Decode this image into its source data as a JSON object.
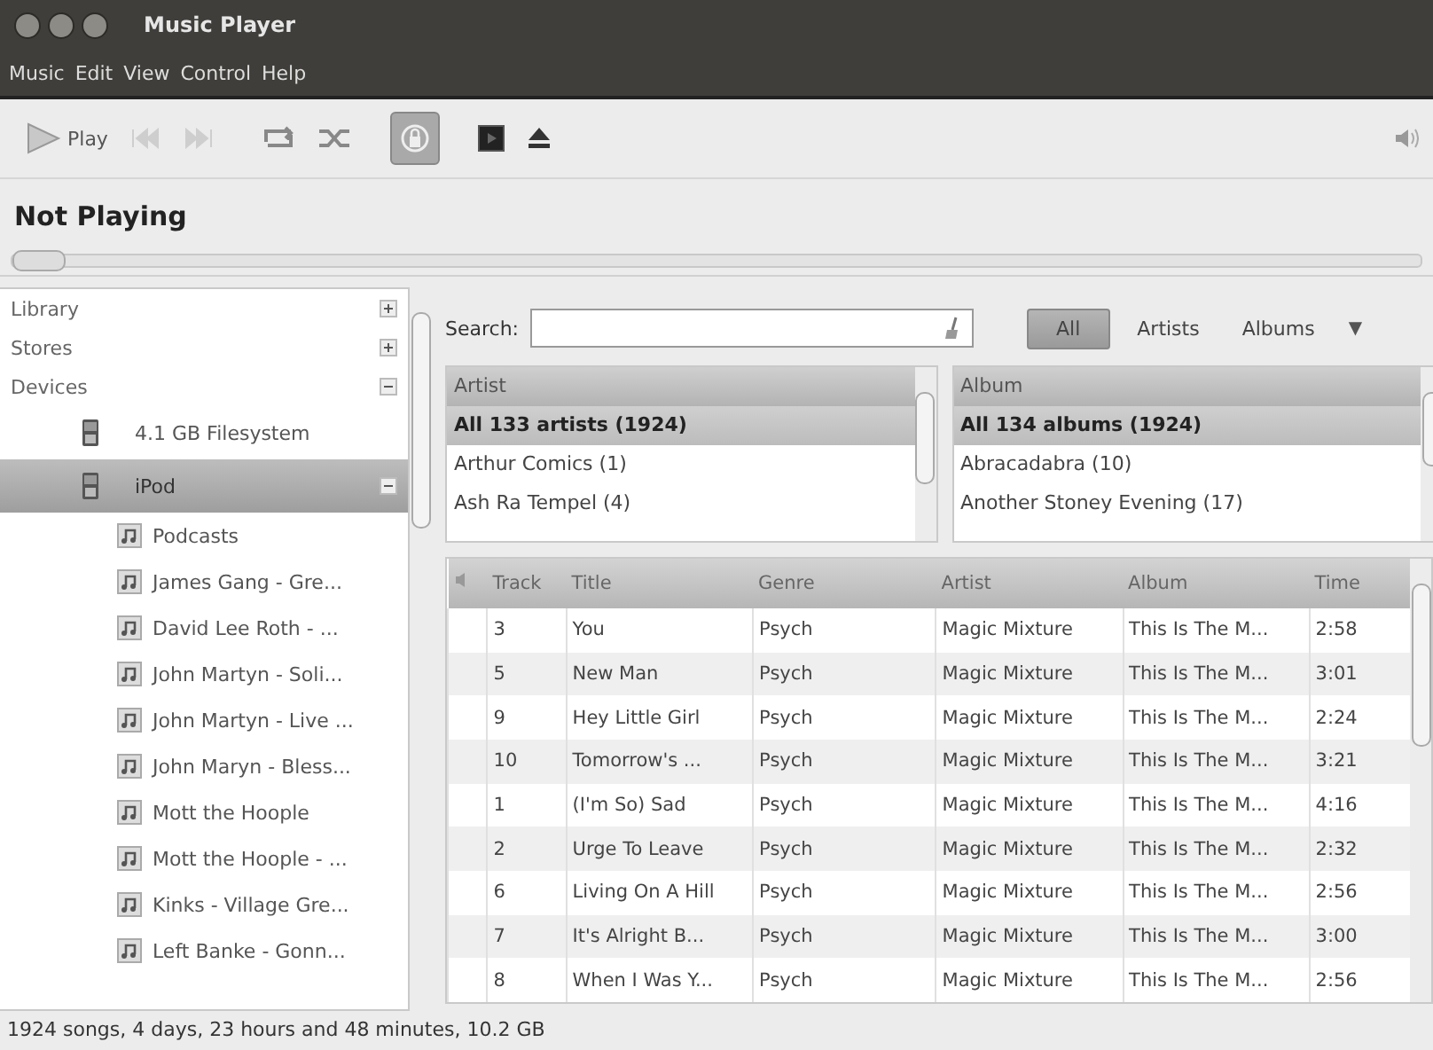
{
  "window": {
    "title": "Music Player"
  },
  "menu": [
    "Music",
    "Edit",
    "View",
    "Control",
    "Help"
  ],
  "toolbar": {
    "buttons": [
      {
        "kind": "play",
        "label": "Play",
        "disabled": false,
        "on": false
      },
      {
        "kind": "previous",
        "disabled": true,
        "on": false
      },
      {
        "kind": "next",
        "disabled": true,
        "on": false
      },
      {
        "kind": "repeat",
        "disabled": false,
        "on": false
      },
      {
        "kind": "shuffle",
        "disabled": false,
        "on": false
      },
      {
        "kind": "sync",
        "disabled": false,
        "on": true
      },
      {
        "kind": "visualizer",
        "disabled": false,
        "on": false
      },
      {
        "kind": "eject",
        "disabled": false,
        "on": false
      }
    ]
  },
  "now_playing": "Not Playing",
  "seek": {
    "level": 0
  },
  "sidebar": {
    "items": [
      {
        "label": "Library",
        "kind": "category",
        "expanded": false,
        "selected": false
      },
      {
        "label": "Stores",
        "kind": "category",
        "expanded": false,
        "selected": false
      },
      {
        "label": "Devices",
        "kind": "category",
        "expanded": true,
        "selected": false,
        "children": [
          {
            "label": "4.1 GB Filesystem",
            "kind": "device",
            "selected": false
          },
          {
            "label": "iPod",
            "kind": "device",
            "expanded": true,
            "selected": true,
            "children": [
              {
                "label": "Podcasts",
                "kind": "playlist",
                "selected": false
              },
              {
                "label": "James Gang - Gre...",
                "kind": "playlist",
                "selected": false
              },
              {
                "label": "David Lee Roth - ...",
                "kind": "playlist",
                "selected": false
              },
              {
                "label": "John Martyn - Soli...",
                "kind": "playlist",
                "selected": false
              },
              {
                "label": "John Martyn - Live ...",
                "kind": "playlist",
                "selected": false
              },
              {
                "label": "John Maryn - Bless...",
                "kind": "playlist",
                "selected": false
              },
              {
                "label": "Mott the Hoople",
                "kind": "playlist",
                "selected": false
              },
              {
                "label": "Mott the Hoople - ...",
                "kind": "playlist",
                "selected": false
              },
              {
                "label": "Kinks - Village Gre...",
                "kind": "playlist",
                "selected": false
              },
              {
                "label": "Left Banke - Gonn...",
                "kind": "playlist",
                "selected": false
              }
            ]
          }
        ]
      }
    ]
  },
  "search": {
    "label": "Search:"
  },
  "filters": [
    {
      "label": "All",
      "selected": true
    },
    {
      "label": "Artists",
      "selected": false
    },
    {
      "label": "Albums",
      "selected": false
    }
  ],
  "filter_menu": "▼",
  "browsers": [
    {
      "heading": "Artist",
      "rows": [
        {
          "label": "All 133 artists (1924)",
          "selected": true
        },
        {
          "label": "Arthur Comics (1)",
          "selected": false
        },
        {
          "label": "Ash Ra Tempel (4)",
          "selected": false
        }
      ]
    },
    {
      "heading": "Album",
      "rows": [
        {
          "label": "All 134 albums (1924)",
          "selected": true
        },
        {
          "label": "Abracadabra (10)",
          "selected": false
        },
        {
          "label": "Another Stoney Evening (17)",
          "selected": false
        }
      ]
    }
  ],
  "tracks": {
    "columns": [
      "Track",
      "Title",
      "Genre",
      "Artist",
      "Album",
      "Time"
    ],
    "rows": [
      [
        "3",
        "You",
        "Psych",
        "Magic Mixture",
        "This Is The M...",
        "2:58"
      ],
      [
        "5",
        "New Man",
        "Psych",
        "Magic Mixture",
        "This Is The M...",
        "3:01"
      ],
      [
        "9",
        "Hey Little Girl",
        "Psych",
        "Magic Mixture",
        "This Is The M...",
        "2:24"
      ],
      [
        "10",
        "Tomorrow's ...",
        "Psych",
        "Magic Mixture",
        "This Is The M...",
        "3:21"
      ],
      [
        "1",
        "(I'm So) Sad",
        "Psych",
        "Magic Mixture",
        "This Is The M...",
        "4:16"
      ],
      [
        "2",
        "Urge To Leave",
        "Psych",
        "Magic Mixture",
        "This Is The M...",
        "2:32"
      ],
      [
        "6",
        "Living On A Hill",
        "Psych",
        "Magic Mixture",
        "This Is The M...",
        "2:56"
      ],
      [
        "7",
        "It's Alright B...",
        "Psych",
        "Magic Mixture",
        "This Is The M...",
        "3:00"
      ],
      [
        "8",
        "When I Was Y...",
        "Psych",
        "Magic Mixture",
        "This Is The M...",
        "2:56"
      ]
    ]
  },
  "status_bar": "1924 songs, 4 days, 23 hours and 48 minutes, 10.2 GB"
}
